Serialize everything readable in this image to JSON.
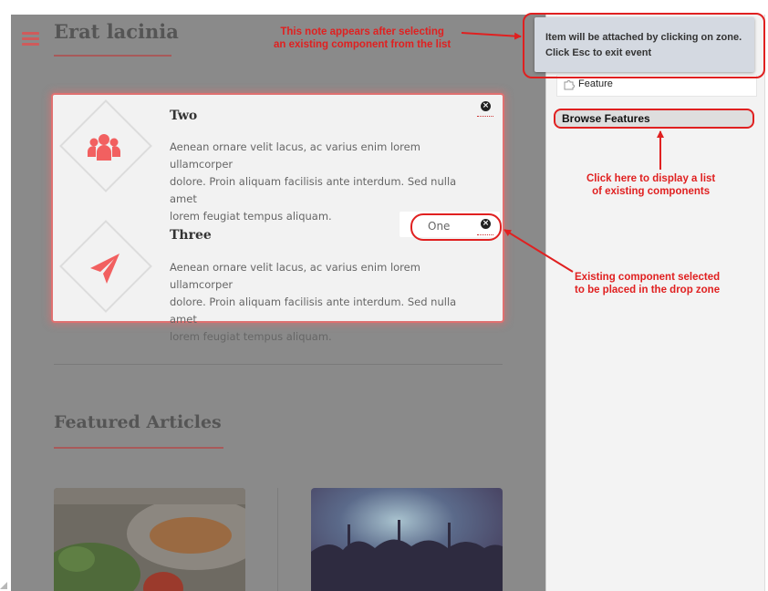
{
  "page": {
    "section_title": "Erat lacinia",
    "features": [
      {
        "title": "Two",
        "icon": "users-icon",
        "text_lines": [
          "Aenean ornare velit lacus, ac varius enim lorem ullamcorper",
          "dolore. Proin aliquam facilisis ante interdum. Sed nulla amet",
          "lorem feugiat tempus aliquam."
        ]
      },
      {
        "title": "Three",
        "icon": "paper-plane-icon",
        "text_lines": [
          "Aenean ornare velit lacus, ac varius enim lorem ullamcorper",
          "dolore. Proin aliquam facilisis ante interdum. Sed nulla amet",
          "lorem feugiat tempus aliquam."
        ]
      }
    ],
    "drop_chip": {
      "label": "One"
    },
    "featured_title": "Featured Articles"
  },
  "sidebar": {
    "note_lines": [
      "Item will be attached by clicking on zone.",
      "Click Esc to exit event"
    ],
    "feature_item": "Feature",
    "browse_button": "Browse Features"
  },
  "annotations": {
    "note": [
      "This note appears after selecting",
      "an existing component from the list"
    ],
    "browse": [
      "Click here to display a list",
      "of existing components"
    ],
    "existing": [
      "Existing component selected",
      "to be placed in the drop zone"
    ]
  },
  "colors": {
    "accent": "#e02020",
    "brand": "#f26060",
    "overlay": "#8a8a8a"
  }
}
